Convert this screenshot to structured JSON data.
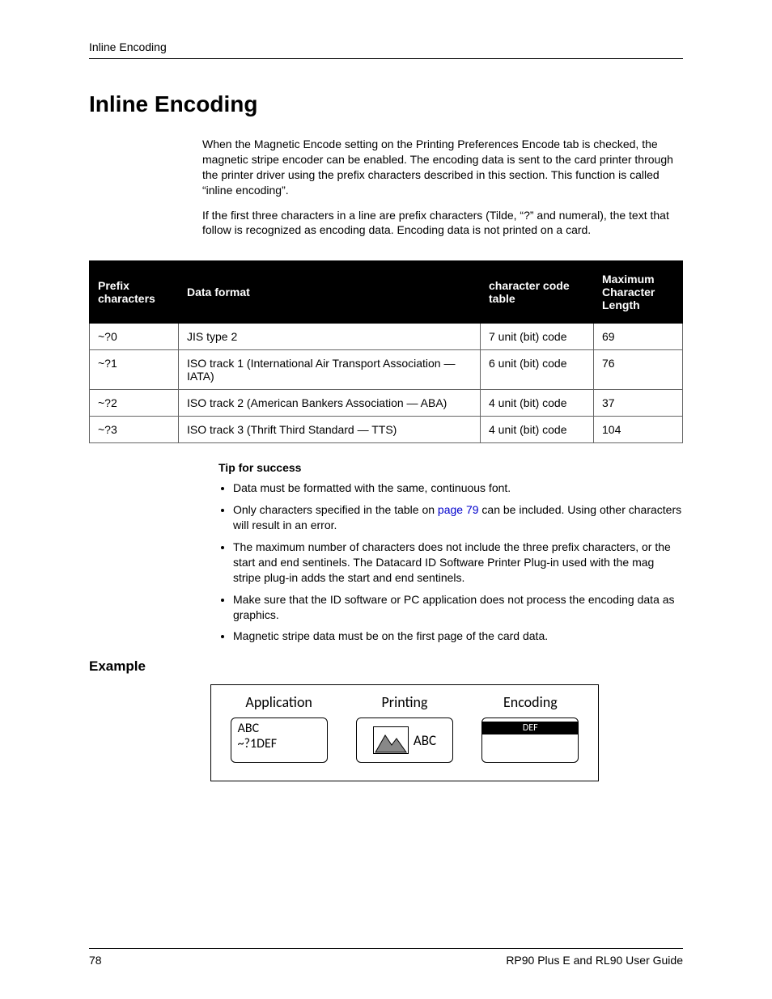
{
  "header": {
    "running": "Inline Encoding"
  },
  "title": "Inline Encoding",
  "intro": {
    "p1": "When the Magnetic Encode setting on the Printing Preferences Encode tab is checked, the magnetic stripe encoder can be enabled. The encoding data is sent to the card printer through the printer driver using the prefix characters described in this section. This function is called “inline encoding”.",
    "p2": "If the first three characters in a line are prefix characters (Tilde, “?” and numeral), the text that follow is recognized as encoding data. Encoding data is not printed on a card."
  },
  "table": {
    "headers": {
      "c0": "Prefix characters",
      "c1": "Data format",
      "c2": "character code table",
      "c3": "Maximum Character Length"
    },
    "rows": [
      {
        "c0": "~?0",
        "c1": "JIS type 2",
        "c2": "7 unit (bit) code",
        "c3": "69"
      },
      {
        "c0": "~?1",
        "c1": "ISO track 1 (International Air Transport Association — IATA)",
        "c2": "6 unit (bit) code",
        "c3": "76"
      },
      {
        "c0": "~?2",
        "c1": "ISO track 2 (American Bankers Association — ABA)",
        "c2": "4 unit (bit) code",
        "c3": "37"
      },
      {
        "c0": "~?3",
        "c1": "ISO track 3 (Thrift Third Standard — TTS)",
        "c2": "4 unit (bit) code",
        "c3": "104"
      }
    ]
  },
  "tips": {
    "heading": "Tip for success",
    "items": {
      "t0": "Data must be formatted with the same, continuous font.",
      "t1a": "Only characters specified in the table on ",
      "t1link": "page 79",
      "t1b": " can be included. Using other characters will result in an error.",
      "t2": "The maximum number of characters does not include the three prefix characters, or the start and end sentinels. The Datacard ID Software Printer Plug-in used with the mag stripe plug-in adds the start and end sentinels.",
      "t3": "Make sure that the ID software or PC application does not process the encoding data as graphics.",
      "t4": "Magnetic stripe data must be on the first page of the card data."
    }
  },
  "example": {
    "heading": "Example",
    "labels": {
      "app": "Application",
      "print": "Printing",
      "encode": "Encoding"
    },
    "appLine1": "ABC",
    "appLine2": "~?1DEF",
    "printText": "ABC",
    "encodeText": "DEF"
  },
  "footer": {
    "page": "78",
    "title": "RP90 Plus E and RL90 User Guide"
  }
}
